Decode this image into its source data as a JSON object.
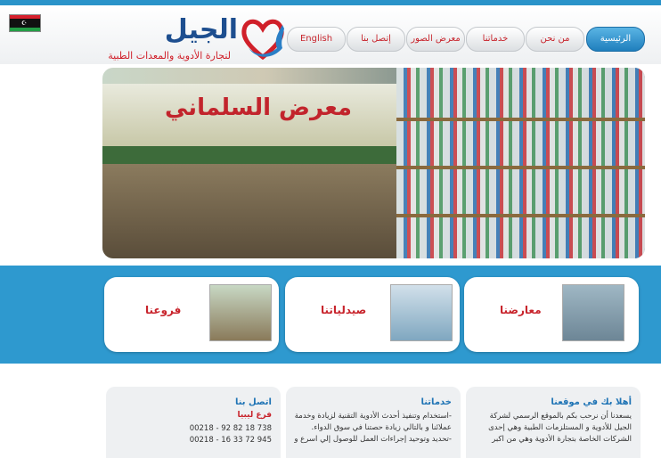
{
  "header": {
    "logo_name": "الجيل",
    "logo_tagline": "لتجارة الأدوية والمعدات الطبية",
    "logo_mark": "heart-hand-icon",
    "flag": "libya-flag"
  },
  "nav": {
    "items": [
      {
        "label": "الرئيسية",
        "active": true
      },
      {
        "label": "من نحن",
        "active": false
      },
      {
        "label": "خدماتنا",
        "active": false
      },
      {
        "label": "معرض الصور",
        "active": false
      },
      {
        "label": "إتصل بنا",
        "active": false
      },
      {
        "label": "English",
        "active": false
      }
    ]
  },
  "banner": {
    "sign_text": "معرض السلماني"
  },
  "cards": [
    {
      "title": "معارضنا",
      "icon": "showroom-photo"
    },
    {
      "title": "صيدلياتنا",
      "icon": "pharmacy-photo"
    },
    {
      "title": "فروعنا",
      "icon": "branch-photo"
    }
  ],
  "panels": {
    "welcome": {
      "title": "أهلا بك في موقعنا",
      "lines": [
        "يسعدنا أن نرحب بكم بالموقع الرسمي لشركة",
        "الجيل للأدوية و المستلزمات الطبية وهي إحدى",
        "الشركات الخاصة بتجارة الأدوية وهي من اكبر"
      ]
    },
    "services": {
      "title": "خدماتنا",
      "lines": [
        "-استخدام وتنفيذ أحدث الأدوية التقنية لزيادة وخدمة",
        "عملائنا و بالتالي زيادة حصتنا في سوق الدواء.",
        "-تحديد وتوحيد إجراءات العمل للوصول إلي اسرع و"
      ]
    },
    "contact": {
      "title": "اتصل بنا",
      "branch": "فرع ليبيا",
      "phones": [
        "00218 - 92 82 18 738",
        "00218 - 16 33 72 945"
      ]
    }
  },
  "colors": {
    "primary_blue": "#2e99cf",
    "brand_red": "#c8242c",
    "brand_navy": "#1d4e8f"
  }
}
